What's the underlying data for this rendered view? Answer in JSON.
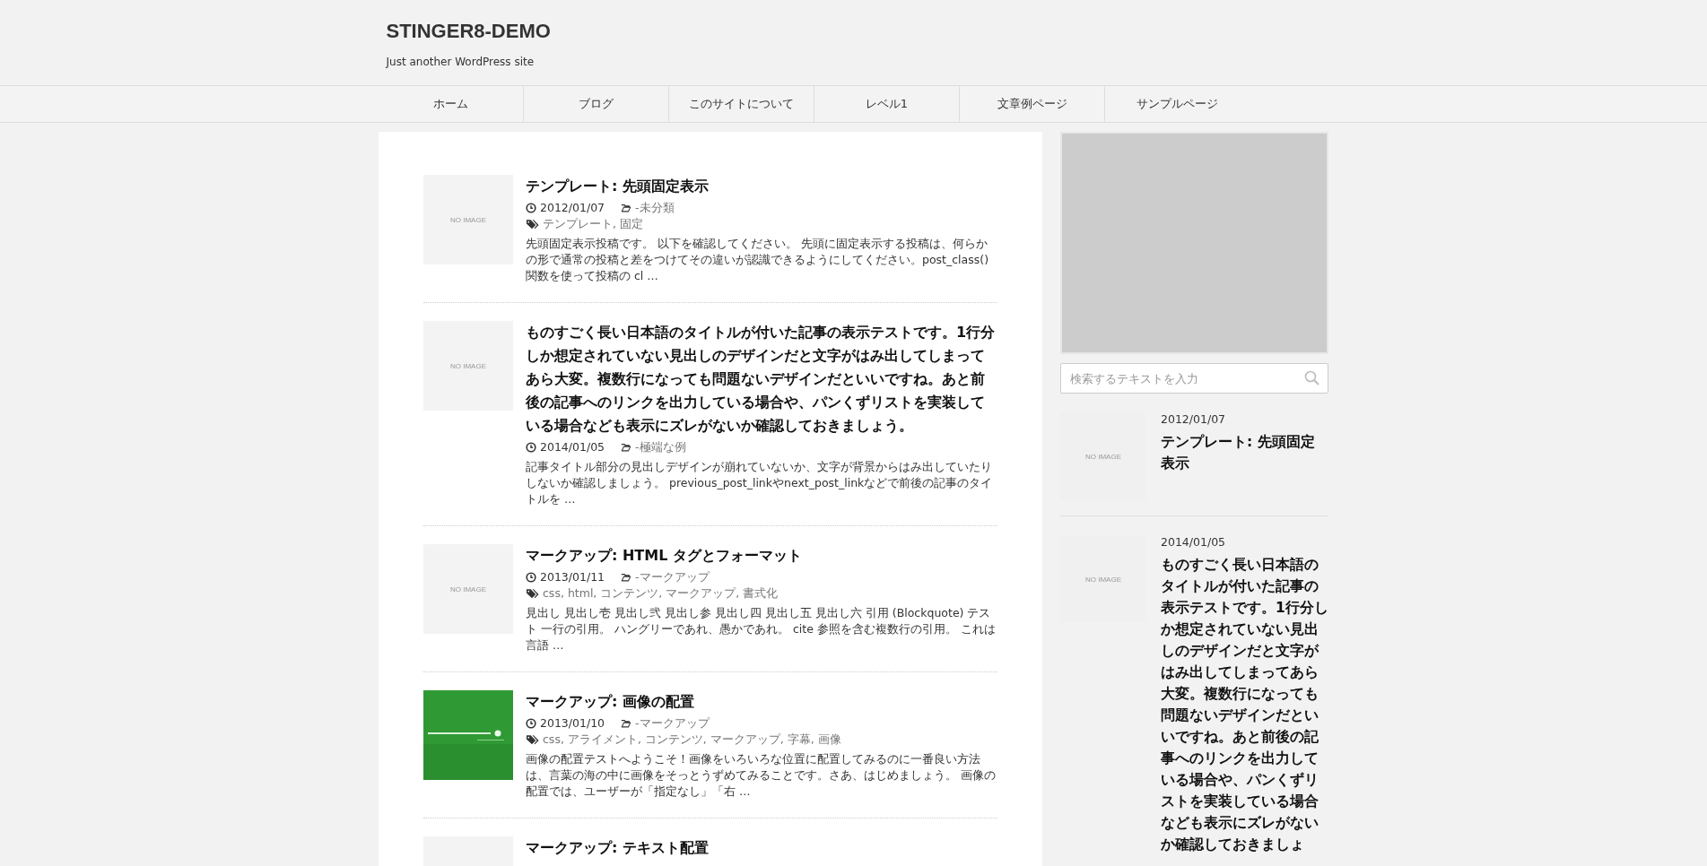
{
  "site": {
    "title": "STINGER8-DEMO",
    "tagline": "Just another WordPress site"
  },
  "nav": [
    {
      "label": "ホーム"
    },
    {
      "label": "ブログ"
    },
    {
      "label": "このサイトについて"
    },
    {
      "label": "レベル1"
    },
    {
      "label": "文章例ページ"
    },
    {
      "label": "サンプルページ"
    }
  ],
  "posts": [
    {
      "title": "テンプレート: 先頭固定表示",
      "date": "2012/01/07",
      "category": "-未分類",
      "tags": [
        "テンプレート,",
        "固定"
      ],
      "excerpt": "先頭固定表示投稿です。 以下を確認してください。 先頭に固定表示する投稿は、何らかの形で通常の投稿と差をつけてその違いが認識できるようにしてください。post_class() 関数を使って投稿の cl …",
      "thumbnail": {
        "kind": "no_image",
        "text": "NO IMAGE"
      }
    },
    {
      "title": "ものすごく長い日本語のタイトルが付いた記事の表示テストです。1行分しか想定されていない見出しのデザインだと文字がはみ出してしまってあら大変。複数行になっても問題ないデザインだといいですね。あと前後の記事へのリンクを出力している場合や、パンくずリストを実装している場合なども表示にズレがないか確認しておきましょう。",
      "date": "2014/01/05",
      "category": "-極端な例",
      "excerpt": "記事タイトル部分の見出しデザインが崩れていないか、文字が背景からはみ出していたりしないか確認しましょう。 previous_post_linkやnext_post_linkなどで前後の記事のタイトルを …",
      "thumbnail": {
        "kind": "no_image",
        "text": "NO IMAGE"
      }
    },
    {
      "title": "マークアップ: HTML タグとフォーマット",
      "date": "2013/01/11",
      "category": "-マークアップ",
      "tags": [
        "css,",
        "html,",
        "コンテンツ,",
        "マークアップ,",
        "書式化"
      ],
      "excerpt": "見出し 見出し壱 見出し弐 見出し参 見出し四 見出し五 見出し六 引用 (Blockquote) テスト 一行の引用。 ハングリーであれ、愚かであれ。 cite 参照を含む複数行の引用。 これは言語 …",
      "thumbnail": {
        "kind": "no_image",
        "text": "NO IMAGE"
      }
    },
    {
      "title": "マークアップ: 画像の配置",
      "date": "2013/01/10",
      "category": "-マークアップ",
      "tags": [
        "css,",
        "アライメント,",
        "コンテンツ,",
        "マークアップ,",
        "字幕,",
        "画像"
      ],
      "excerpt": "画像の配置テストへようこそ！画像をいろいろな位置に配置してみるのに一番良い方法は、言葉の海の中に画像をそっとうずめてみることです。さあ、はじめましょう。 画像の配置では、ユーザーが「指定なし」「右 …"
    },
    {
      "title": "マークアップ: テキスト配置",
      "thumbnail": {
        "kind": "no_image"
      }
    }
  ],
  "sidebar": {
    "search": {
      "placeholder": "検索するテキストを入力"
    },
    "recent": [
      {
        "date": "2012/01/07",
        "title": "テンプレート: 先頭固定表示",
        "thumbnail": {
          "kind": "no_image",
          "text": "NO IMAGE"
        }
      },
      {
        "date": "2014/01/05",
        "title": "ものすごく長い日本語のタイトルが付いた記事の表示テストです。1行分しか想定されていない見出しのデザインだと文字がはみ出してしまってあら大変。複数行になっても問題ないデザインだといいですね。あと前後の記事へのリンクを出力している場合や、パンくずリストを実装している場合なども表示にズレがないか確認しておきましょ",
        "thumbnail": {
          "kind": "no_image",
          "text": "NO IMAGE"
        }
      }
    ]
  }
}
